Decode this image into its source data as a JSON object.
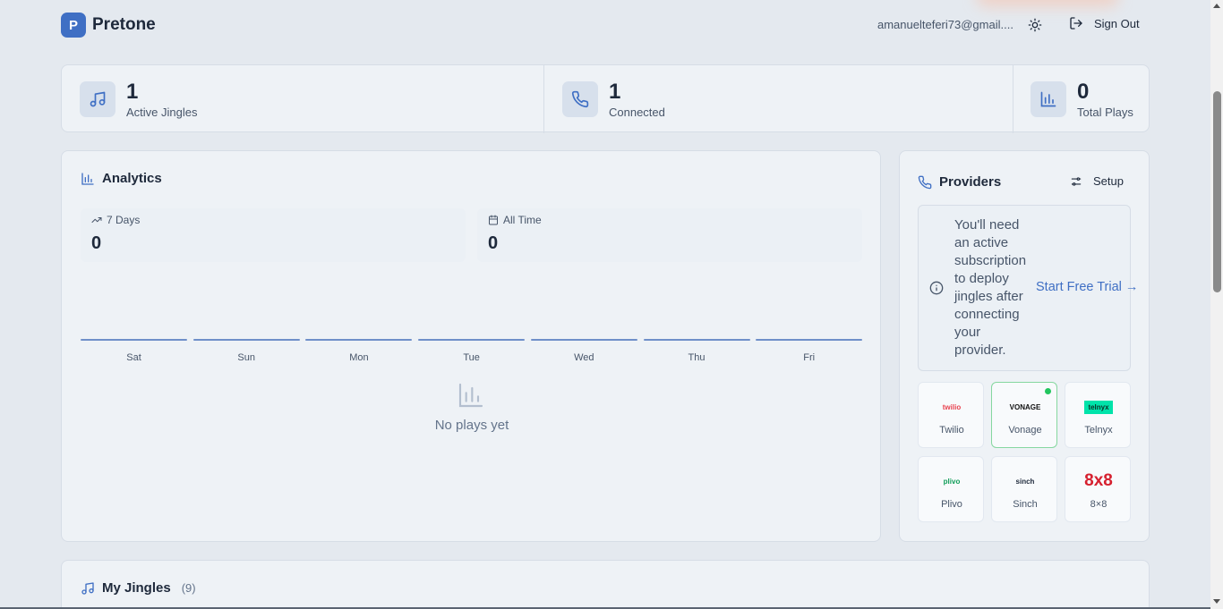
{
  "header": {
    "brand_letter": "P",
    "brand_name": "Pretone",
    "user_email": "amanueltefer i73@gmail....",
    "theme_toggle_icon": "sun-icon",
    "signout_icon": "log-out-icon",
    "signout_label": "Sign Out"
  },
  "stats": [
    {
      "icon": "music-note-icon",
      "value": "1",
      "label": "Active Jingles"
    },
    {
      "icon": "phone-icon",
      "value": "1",
      "label": "Connected"
    },
    {
      "icon": "bar-chart-icon",
      "value": "0",
      "label": "Total Plays"
    }
  ],
  "analytics": {
    "title": "Analytics",
    "metrics": [
      {
        "icon": "trending-up-icon",
        "label": "7 Days",
        "value": "0"
      },
      {
        "icon": "calendar-icon",
        "label": "All Time",
        "value": "0"
      }
    ],
    "days": [
      "Sat",
      "Sun",
      "Mon",
      "Tue",
      "Wed",
      "Thu",
      "Fri"
    ],
    "plays": [
      0,
      0,
      0,
      0,
      0,
      0,
      0
    ],
    "empty_text": "No plays yet"
  },
  "providers": {
    "title": "Providers",
    "setup_label": "Setup",
    "notice_text": "You'll need an active subscription to deploy jingles after connecting your provider.",
    "trial_link": "Start Free Trial →",
    "items": [
      {
        "name": "Twilio",
        "logo_text": "twilio",
        "logo_color": "#e8424f",
        "connected": false
      },
      {
        "name": "Vonage",
        "logo_text": "VONAGE",
        "logo_color": "#111111",
        "connected": true
      },
      {
        "name": "Telnyx",
        "logo_text": "telnyx",
        "logo_color": "#00e3aa",
        "connected": false
      },
      {
        "name": "Plivo",
        "logo_text": "plivo",
        "logo_color": "#0f9d58",
        "connected": false
      },
      {
        "name": "Sinch",
        "logo_text": "sinch",
        "logo_color": "#1e293b",
        "connected": false
      },
      {
        "name": "8×8",
        "logo_text": "8x8",
        "logo_color": "#d6202f",
        "connected": false
      }
    ]
  },
  "jingles": {
    "title": "My Jingles",
    "count": "(9)"
  },
  "colors": {
    "accent": "#3f6fc4",
    "background": "#e4e9ef",
    "card": "#eef2f6",
    "connected_dot": "#22c55e"
  }
}
